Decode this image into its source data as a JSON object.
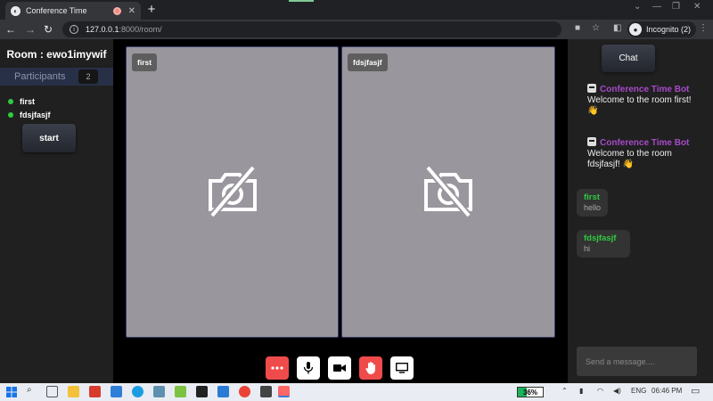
{
  "browser": {
    "tab_title": "Conference Time",
    "url_host": "127.0.0.1",
    "url_rest": ":8000/room/",
    "profile_label": "Incognito (2)"
  },
  "room": {
    "title": "Room : ewo1imywif",
    "participants_label": "Participants",
    "participants_count": "2",
    "participants": [
      {
        "name": "first"
      },
      {
        "name": "fdsjfasjf"
      }
    ],
    "start_label": "start"
  },
  "videos": [
    {
      "name": "first"
    },
    {
      "name": "fdsjfasjf"
    }
  ],
  "chat": {
    "button_label": "Chat",
    "bot_messages": [
      {
        "sender": "Conference Time Bot",
        "text": "Welcome to the room first! 👋"
      },
      {
        "sender": "Conference Time Bot",
        "text": "Welcome to the room fdsjfasjf! 👋"
      }
    ],
    "user_messages": [
      {
        "sender": "first",
        "text": "hello"
      },
      {
        "sender": "fdsjfasjf",
        "text": "hi"
      }
    ],
    "input_placeholder": "Send a message...."
  },
  "controls": {
    "colors": {
      "danger": "#f04b4b",
      "neutral": "#ffffff"
    },
    "icons": [
      "more-icon",
      "microphone-icon",
      "camera-icon",
      "raise-hand-icon",
      "screen-share-icon"
    ]
  },
  "taskbar": {
    "battery": "36%",
    "language": "ENG",
    "time": "06:46 PM"
  }
}
